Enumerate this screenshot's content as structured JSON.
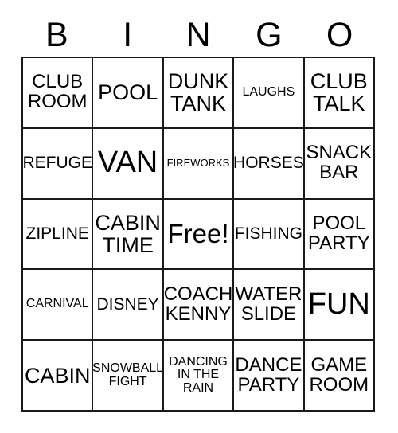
{
  "card": {
    "header_letters": [
      "B",
      "I",
      "N",
      "G",
      "O"
    ],
    "free_space_label": "Free!",
    "colors": {
      "grid_line": "#1a1a1a",
      "cell_background": "#ffffff",
      "text": "#000000"
    },
    "rows": [
      [
        {
          "text": "CLUB\nROOM",
          "size": "lg"
        },
        {
          "text": "POOL",
          "size": "xl"
        },
        {
          "text": "DUNK\nTANK",
          "size": "xl"
        },
        {
          "text": "LAUGHS",
          "size": "sm"
        },
        {
          "text": "CLUB\nTALK",
          "size": "xl"
        }
      ],
      [
        {
          "text": "REFUGE",
          "size": "md"
        },
        {
          "text": "VAN",
          "size": "xxl"
        },
        {
          "text": "FIREWORKS",
          "size": "xs"
        },
        {
          "text": "HORSES",
          "size": "md"
        },
        {
          "text": "SNACK\nBAR",
          "size": "lg"
        }
      ],
      [
        {
          "text": "ZIPLINE",
          "size": "md"
        },
        {
          "text": "CABIN\nTIME",
          "size": "xl"
        },
        {
          "text": "Free!",
          "size": "free"
        },
        {
          "text": "FISHING",
          "size": "md"
        },
        {
          "text": "POOL\nPARTY",
          "size": "lg"
        }
      ],
      [
        {
          "text": "CARNIVAL",
          "size": "sm"
        },
        {
          "text": "DISNEY",
          "size": "md"
        },
        {
          "text": "COACH\nKENNY",
          "size": "lg"
        },
        {
          "text": "WATER\nSLIDE",
          "size": "lg"
        },
        {
          "text": "FUN",
          "size": "xxl"
        }
      ],
      [
        {
          "text": "CABIN",
          "size": "xl"
        },
        {
          "text": "SNOWBALL\nFIGHT",
          "size": "sm"
        },
        {
          "text": "DANCING\nIN THE\nRAIN",
          "size": "sm"
        },
        {
          "text": "DANCE\nPARTY",
          "size": "lg"
        },
        {
          "text": "GAME\nROOM",
          "size": "lg"
        }
      ]
    ]
  }
}
